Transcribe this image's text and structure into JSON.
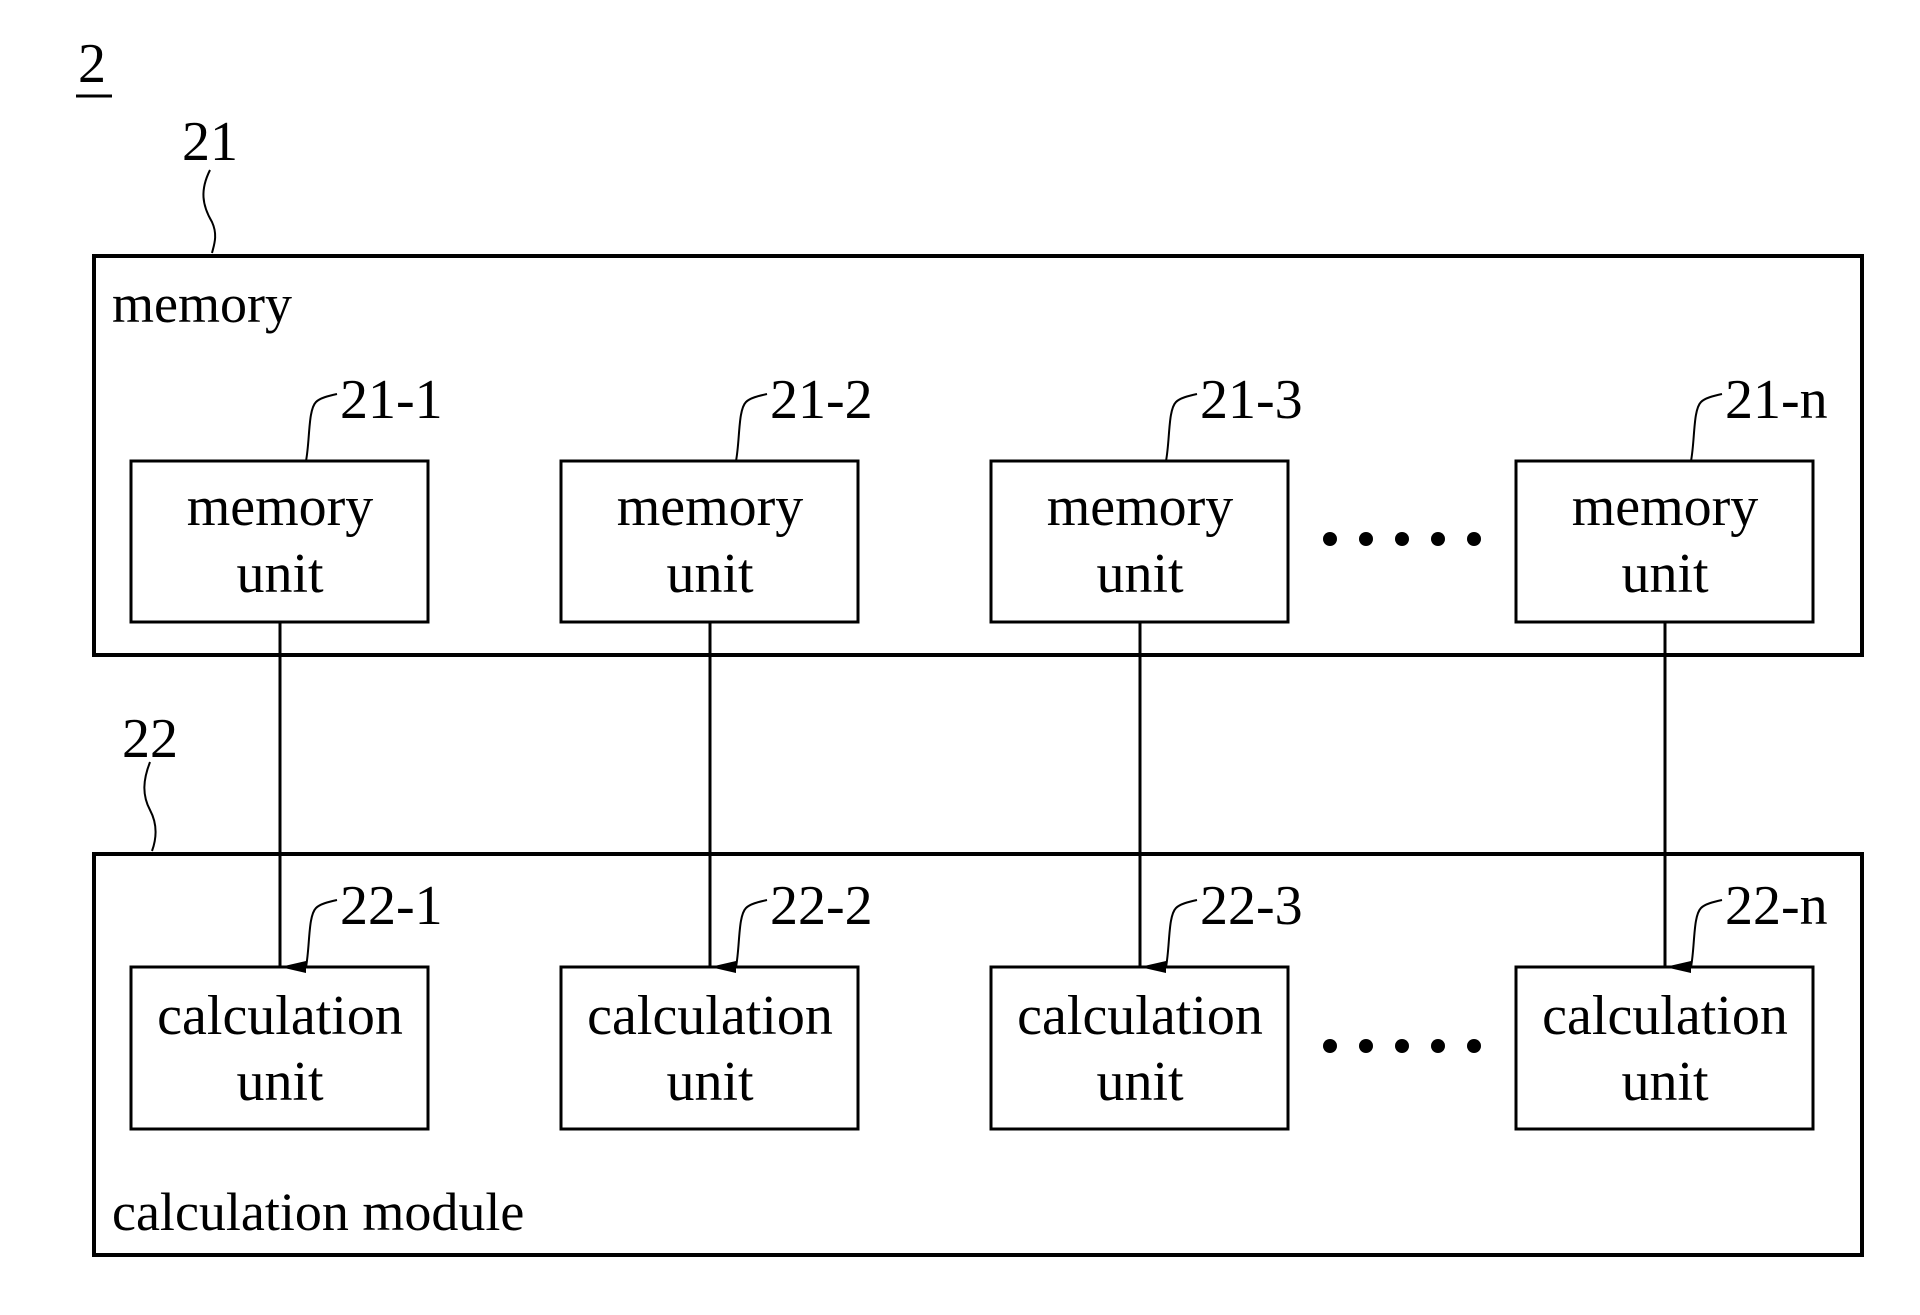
{
  "figure": {
    "number": "2",
    "memory": {
      "ref": "21",
      "title": "memory",
      "units": [
        {
          "ref": "21-1",
          "line1": "memory",
          "line2": "unit"
        },
        {
          "ref": "21-2",
          "line1": "memory",
          "line2": "unit"
        },
        {
          "ref": "21-3",
          "line1": "memory",
          "line2": "unit"
        },
        {
          "ref": "21-n",
          "line1": "memory",
          "line2": "unit"
        }
      ]
    },
    "calculation": {
      "ref": "22",
      "title": "calculation module",
      "units": [
        {
          "ref": "22-1",
          "line1": "calculation",
          "line2": "unit"
        },
        {
          "ref": "22-2",
          "line1": "calculation",
          "line2": "unit"
        },
        {
          "ref": "22-3",
          "line1": "calculation",
          "line2": "unit"
        },
        {
          "ref": "22-n",
          "line1": "calculation",
          "line2": "unit"
        }
      ]
    },
    "ellipsis": "•••••",
    "connections": [
      {
        "from": "21-1",
        "to": "22-1"
      },
      {
        "from": "21-2",
        "to": "22-2"
      },
      {
        "from": "21-3",
        "to": "22-3"
      },
      {
        "from": "21-n",
        "to": "22-n"
      }
    ]
  }
}
